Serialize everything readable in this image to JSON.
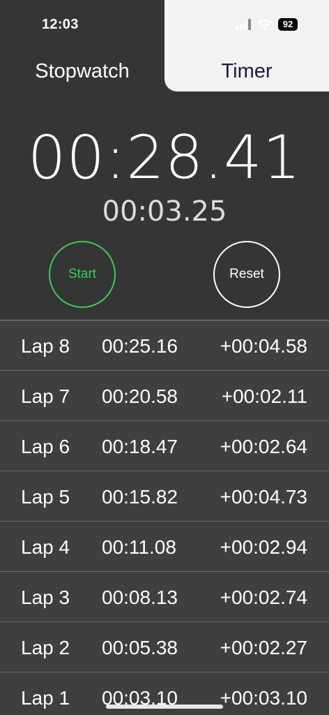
{
  "status_bar": {
    "time": "12:03",
    "battery": "92"
  },
  "tabs": {
    "stopwatch": "Stopwatch",
    "timer": "Timer",
    "active": "Stopwatch"
  },
  "display": {
    "main_time": "00:28.41",
    "lap_time": "00:03.25"
  },
  "buttons": {
    "start": "Start",
    "reset": "Reset"
  },
  "laps": [
    {
      "name": "Lap 8",
      "total": "00:25.16",
      "split": "+00:04.58"
    },
    {
      "name": "Lap 7",
      "total": "00:20.58",
      "split": "+00:02.11"
    },
    {
      "name": "Lap 6",
      "total": "00:18.47",
      "split": "+00:02.64"
    },
    {
      "name": "Lap 5",
      "total": "00:15.82",
      "split": "+00:04.73"
    },
    {
      "name": "Lap 4",
      "total": "00:11.08",
      "split": "+00:02.94"
    },
    {
      "name": "Lap 3",
      "total": "00:08.13",
      "split": "+00:02.74"
    },
    {
      "name": "Lap 2",
      "total": "00:05.38",
      "split": "+00:02.27"
    },
    {
      "name": "Lap 1",
      "total": "00:03.10",
      "split": "+00:03.10"
    }
  ],
  "colors": {
    "start_accent": "#3ccb5a",
    "background": "#3a3a3a",
    "timer_tab_bg": "#f2f2f2"
  },
  "icons": [
    "signal-icon",
    "wifi-icon",
    "battery-icon"
  ]
}
